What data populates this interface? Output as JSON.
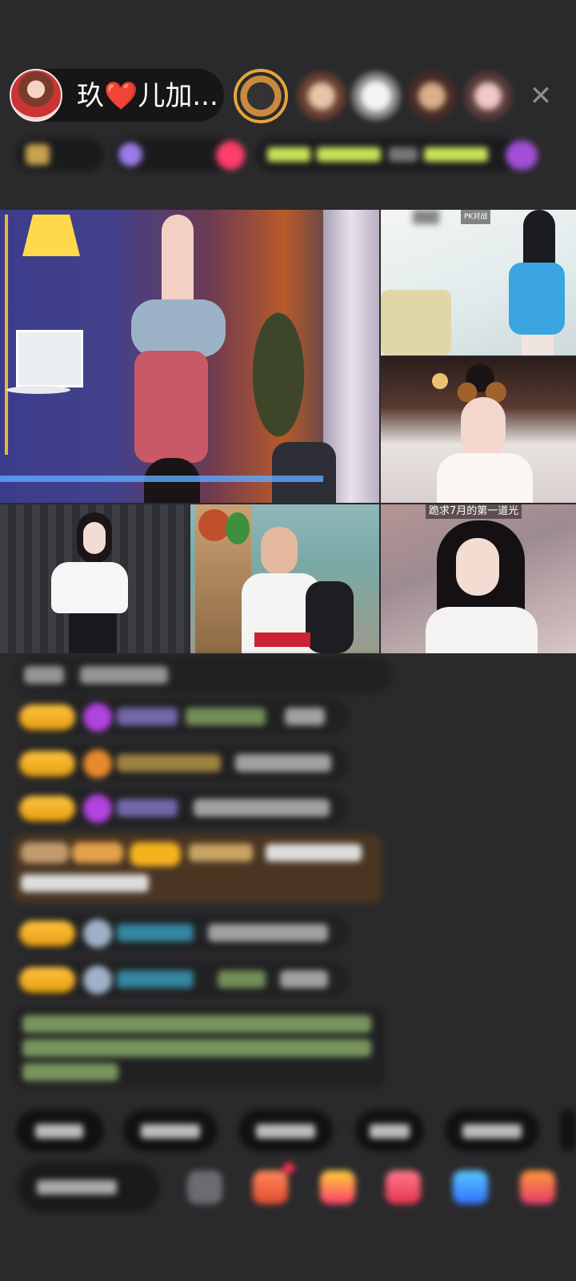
{
  "host": {
    "name": "玖❤️儿加..."
  },
  "viewers": [
    {
      "icon": "viewer-avatar-1",
      "ring": "#e6a43a"
    },
    {
      "icon": "viewer-avatar-2",
      "ring": ""
    },
    {
      "icon": "viewer-avatar-3",
      "ring": ""
    },
    {
      "icon": "viewer-avatar-4",
      "ring": ""
    },
    {
      "icon": "viewer-avatar-5",
      "ring": ""
    }
  ],
  "close_glyph": "✕",
  "video_tiles": {
    "bottom_right_caption": "跪求7月的第一道光",
    "top_right_caption": "PK对战"
  },
  "chat": {
    "rows_count_visible": 9
  },
  "colors": {
    "background": "#2a2a2c",
    "level_tag": "#f5b21e",
    "purple_badge": "#b143e0",
    "accent_pink": "#ff3e6c",
    "highlight_green": "#c8e25a",
    "name_cyan": "#39a8c9",
    "message_box_brown": "#4a3522"
  }
}
